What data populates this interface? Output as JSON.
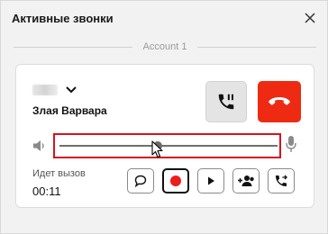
{
  "window": {
    "title": "Активные звонки"
  },
  "account": {
    "label": "Account 1"
  },
  "call": {
    "caller_name": "Злая Варвара",
    "status": "Идет вызов",
    "duration": "00:11",
    "volume": 0.45
  },
  "icons": {
    "close": "close-icon",
    "expand": "chevron-down-icon",
    "hold": "phone-pause-icon",
    "hangup": "phone-hangup-icon",
    "speaker": "speaker-icon",
    "mic": "microphone-icon",
    "chat": "chat-bubble-icon",
    "record": "record-icon",
    "play": "play-icon",
    "conference": "add-participant-icon",
    "transfer": "call-transfer-icon"
  },
  "colors": {
    "hangup": "#ee2a12",
    "record": "#ee1c1c",
    "highlight": "#d4141e",
    "hold_bg": "#e4e4e4"
  }
}
